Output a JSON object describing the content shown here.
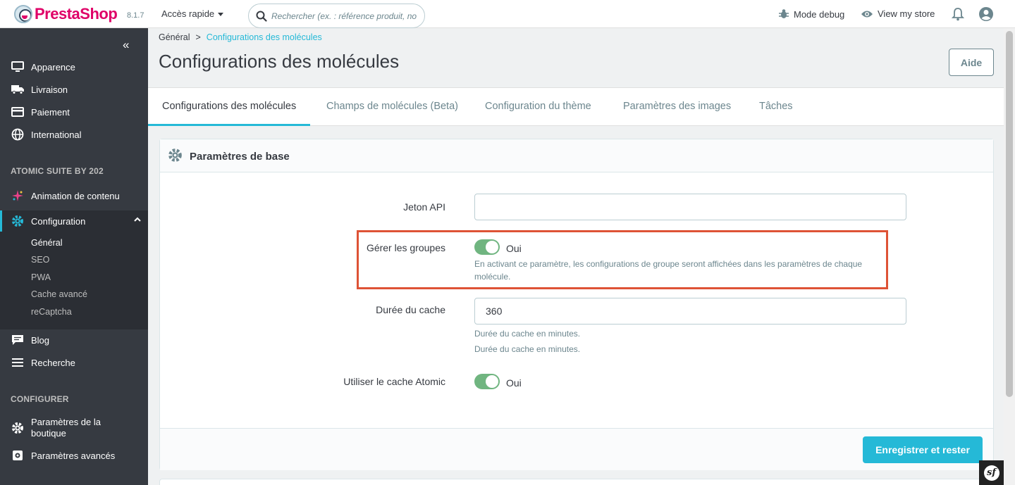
{
  "header": {
    "brand": "PrestaShop",
    "version": "8.1.7",
    "quick_access": "Accès rapide",
    "search_placeholder": "Rechercher (ex. : référence produit, no",
    "debug_mode": "Mode debug",
    "view_store": "View my store"
  },
  "sidebar": {
    "items_top": [
      {
        "label": "Apparence",
        "icon": "monitor-icon"
      },
      {
        "label": "Livraison",
        "icon": "truck-icon"
      },
      {
        "label": "Paiement",
        "icon": "credit-card-icon"
      },
      {
        "label": "International",
        "icon": "globe-icon"
      }
    ],
    "section_atomic": "ATOMIC SUITE BY 202",
    "animation": "Animation de contenu",
    "configuration": "Configuration",
    "submenu": [
      "Général",
      "SEO",
      "PWA",
      "Cache avancé",
      "reCaptcha"
    ],
    "blog": "Blog",
    "recherche": "Recherche",
    "section_configurer": "CONFIGURER",
    "shop_params": "Paramètres de la boutique",
    "advanced_params": "Paramètres avancés"
  },
  "breadcrumb": {
    "parent": "Général",
    "separator": ">",
    "current": "Configurations des molécules"
  },
  "page": {
    "title": "Configurations des molécules",
    "help_button": "Aide"
  },
  "tabs": [
    {
      "label": "Configurations des molécules",
      "active": true
    },
    {
      "label": "Champs de molécules (Beta)",
      "active": false
    },
    {
      "label": "Configuration du thème",
      "active": false
    },
    {
      "label": "Paramètres des images",
      "active": false
    },
    {
      "label": "Tâches",
      "active": false
    }
  ],
  "card": {
    "title": "Paramètres de base",
    "api_token_label": "Jeton API",
    "api_token_value": "",
    "groups_label": "Gérer les groupes",
    "groups_toggle": "Oui",
    "groups_help_1": "En activant ce paramètre, les configurations de groupe seront affichées dans les paramètres de chaque",
    "groups_help_2": "molécule.",
    "cache_label": "Durée du cache",
    "cache_value": "360",
    "cache_help_1": "Durée du cache en minutes.",
    "cache_help_2": "Durée du cache en minutes.",
    "atomic_cache_label": "Utiliser le cache Atomic",
    "atomic_cache_toggle": "Oui",
    "save_button": "Enregistrer et rester"
  },
  "colors": {
    "accent": "#25b9d7",
    "sidebar_bg": "#363a41",
    "toggle_on": "#70b580",
    "highlight": "#de5336",
    "brand": "#df0067"
  }
}
